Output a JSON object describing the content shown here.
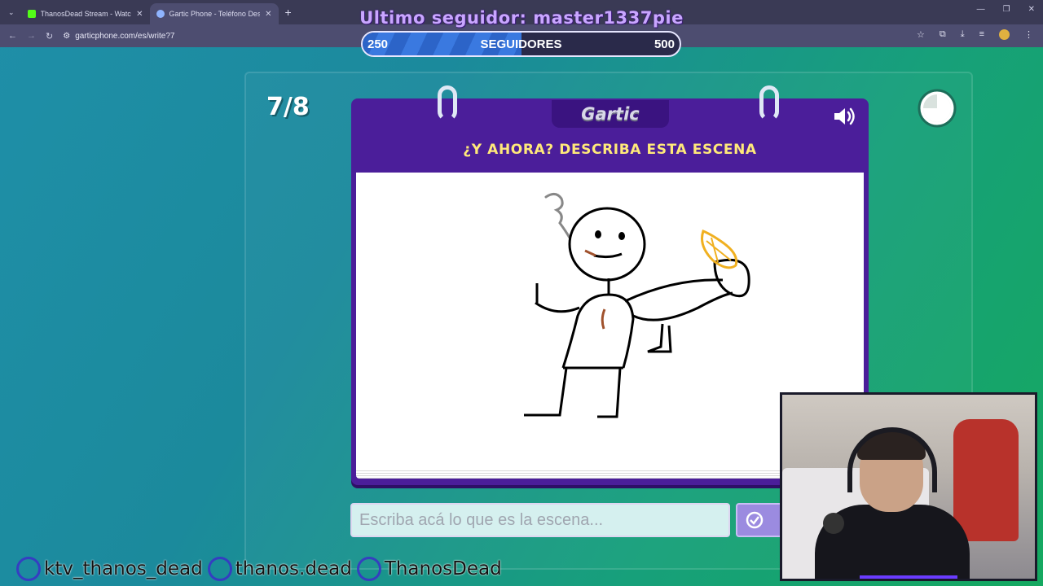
{
  "browser": {
    "tabs": [
      {
        "title": "ThanosDead Stream - Watch Li",
        "active": false,
        "favicon_color": "#53fc18"
      },
      {
        "title": "Gartic Phone - Teléfono Descor",
        "active": true,
        "favicon_color": "#8fb4ff"
      }
    ],
    "new_tab": "+",
    "url": "garticphone.com/es/write?7"
  },
  "overlay": {
    "last_follower": "Ultimo seguidor: master1337pie",
    "followers_label": "SEGUIDORES",
    "followers_current": "250",
    "followers_goal": "500",
    "followers_progress": 0.5,
    "socials": [
      {
        "name": "ktv_thanos_dead",
        "icon": "kick-icon"
      },
      {
        "name": "thanos.dead",
        "icon": "tiktok-icon"
      },
      {
        "name": "ThanosDead",
        "icon": "twitch-icon"
      }
    ]
  },
  "game": {
    "round": "7/8",
    "logo": "Gartic",
    "prompt": "¿Y AHORA? DESCRIBA ESTA ESCENA",
    "answer_placeholder": "Escriba acá lo que es la escena...",
    "accent": "#4b1e9a",
    "prompt_color": "#ffe97a"
  }
}
